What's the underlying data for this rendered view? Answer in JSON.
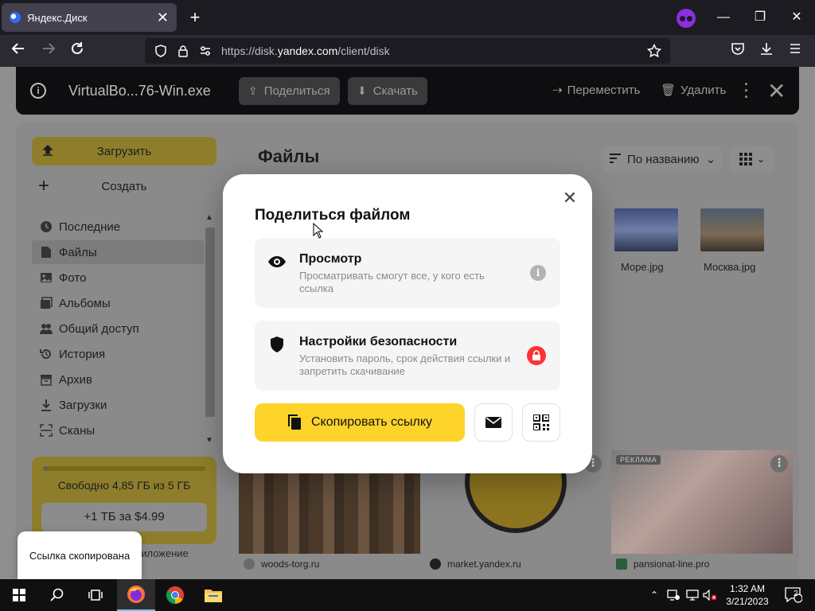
{
  "browser": {
    "tab_title": "Яндекс.Диск",
    "url_prefix": "https://disk.",
    "url_domain": "yandex.com",
    "url_path": "/client/disk"
  },
  "viewer": {
    "filename": "VirtualBo...76-Win.exe",
    "share_label": "Поделиться",
    "download_label": "Скачать",
    "move_label": "Переместить",
    "delete_label": "Удалить"
  },
  "sidebar": {
    "upload_label": "Загрузить",
    "create_label": "Создать",
    "items": [
      {
        "label": "Последние",
        "icon": "clock-icon"
      },
      {
        "label": "Файлы",
        "icon": "file-icon"
      },
      {
        "label": "Фото",
        "icon": "photo-icon"
      },
      {
        "label": "Альбомы",
        "icon": "albums-icon"
      },
      {
        "label": "Общий доступ",
        "icon": "people-icon"
      },
      {
        "label": "История",
        "icon": "history-icon"
      },
      {
        "label": "Архив",
        "icon": "archive-icon"
      },
      {
        "label": "Загрузки",
        "icon": "download-icon"
      },
      {
        "label": "Сканы",
        "icon": "scan-icon"
      }
    ],
    "active_item": "Файлы",
    "storage_free": "Свободно 4,85 ГБ из 5 ГБ",
    "storage_used_fraction": 0.03,
    "buy_label": "+1 ТБ за $4.99",
    "app_link": "риложение"
  },
  "main": {
    "title": "Файлы",
    "sort_label": "По названию",
    "thumbs": [
      {
        "label": "Море.jpg"
      },
      {
        "label": "Москва.jpg"
      }
    ],
    "ads": [
      {
        "domain": "woods-torg.ru"
      },
      {
        "domain": "market.yandex.ru"
      },
      {
        "domain": "pansionat-line.pro",
        "badge": "РЕКЛАМА"
      }
    ]
  },
  "modal": {
    "title": "Поделиться файлом",
    "option_view_title": "Просмотр",
    "option_view_desc": "Просматривать смогут все, у кого есть ссылка",
    "option_security_title": "Настройки безопасности",
    "option_security_desc": "Установить пароль, срок действия ссылки и запретить скачивание",
    "copy_label": "Скопировать ссылку"
  },
  "toast": {
    "text": "Ссылка скопирована"
  },
  "taskbar": {
    "time": "1:32 AM",
    "date": "3/21/2023",
    "notifications": "2"
  },
  "colors": {
    "accent_yellow": "#fed42b",
    "lock_red": "#ff3333",
    "firefox_purple": "#8b2fe0"
  }
}
